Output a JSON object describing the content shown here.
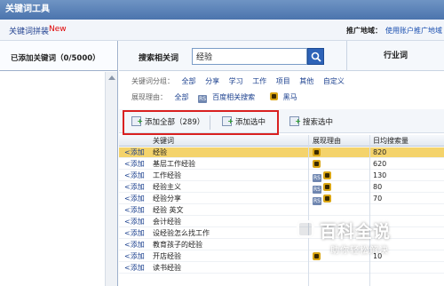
{
  "window": {
    "title": "关键词工具"
  },
  "topbar": {
    "tab_label": "关键词拼装",
    "new_badge": "New",
    "region_label": "推广地域：",
    "region_value": "使用账户推广地域"
  },
  "left_panel": {
    "title": "已添加关键词（0/5000）"
  },
  "search": {
    "label": "搜索相关词",
    "value": "经验",
    "industry_tab": "行业词"
  },
  "filters": {
    "group_label": "关键词分组：",
    "groups": [
      "全部",
      "分享",
      "学习",
      "工作",
      "项目",
      "其他",
      "自定义"
    ],
    "reason_label": "展现理由：",
    "reasons": [
      "全部",
      "百度相关搜索",
      "黑马"
    ]
  },
  "actions": {
    "add_all": "添加全部（289）",
    "add_selected": "添加选中",
    "search_selected": "搜索选中"
  },
  "table": {
    "headers": [
      "关键词",
      "展现理由",
      "日均搜索量"
    ],
    "add_label": "<添加",
    "rows": [
      {
        "keyword": "经验",
        "reasons": [
          "horse"
        ],
        "volume": "820",
        "highlighted": true
      },
      {
        "keyword": "基层工作经验",
        "reasons": [
          "horse"
        ],
        "volume": "620",
        "highlighted": false
      },
      {
        "keyword": "工作经验",
        "reasons": [
          "rs",
          "horse"
        ],
        "volume": "130",
        "highlighted": false
      },
      {
        "keyword": "经验主义",
        "reasons": [
          "rs",
          "horse"
        ],
        "volume": "80",
        "highlighted": false
      },
      {
        "keyword": "经验分享",
        "reasons": [
          "rs",
          "horse"
        ],
        "volume": "70",
        "highlighted": false
      },
      {
        "keyword": "经验 英文",
        "reasons": [],
        "volume": "",
        "highlighted": false
      },
      {
        "keyword": "会计经验",
        "reasons": [],
        "volume": "",
        "highlighted": false
      },
      {
        "keyword": "设经验怎么找工作",
        "reasons": [],
        "volume": "",
        "highlighted": false
      },
      {
        "keyword": "教育孩子的经验",
        "reasons": [],
        "volume": "",
        "highlighted": false
      },
      {
        "keyword": "开店经验",
        "reasons": [
          "horse"
        ],
        "volume": "10",
        "highlighted": false
      },
      {
        "keyword": "读书经验",
        "reasons": [],
        "volume": "",
        "highlighted": false
      }
    ]
  },
  "watermark": {
    "title": "百科全说",
    "subtitle": "助你轻松解决"
  },
  "colors": {
    "highlight_row": "#f4d36b",
    "red_box": "#d92020",
    "link": "#1a3f8e"
  }
}
